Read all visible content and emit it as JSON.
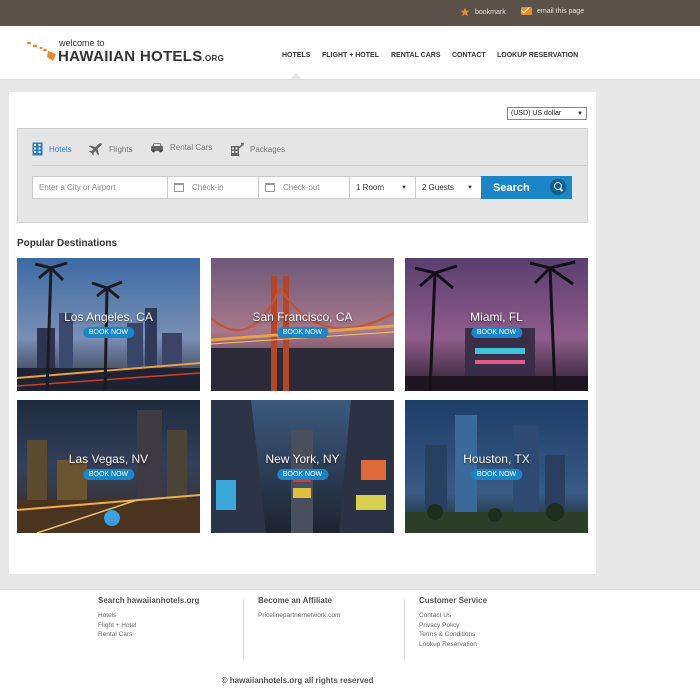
{
  "topbar": {
    "bookmark_label": "bookmark",
    "email_label": "email this page"
  },
  "logo": {
    "welcome": "welcome to",
    "name": "HAWAIIAN HOTELS",
    "suffix": ".ORG"
  },
  "nav": {
    "items": [
      {
        "label": "HOTELS"
      },
      {
        "label": "FLIGHT + HOTEL"
      },
      {
        "label": "RENTAL CARS"
      },
      {
        "label": "CONTACT"
      },
      {
        "label": "LOOKUP RESERVATION"
      }
    ]
  },
  "currency": {
    "selected": "(USD) US dollar"
  },
  "search": {
    "tabs": [
      {
        "label": "Hotels",
        "icon": "building-icon"
      },
      {
        "label": "Flights",
        "icon": "airplane-icon"
      },
      {
        "label": "Rental Cars",
        "icon": "car-icon"
      },
      {
        "label": "Packages",
        "icon": "package-icon"
      }
    ],
    "city_placeholder": "Enter a City or Airport",
    "checkin_placeholder": "Check-in",
    "checkout_placeholder": "Check-out",
    "rooms_value": "1 Room",
    "guests_value": "2 Guests",
    "button_label": "Search"
  },
  "popular": {
    "title": "Popular Destinations",
    "book_label": "BOOK NOW",
    "destinations": [
      {
        "city": "Los Angeles, CA"
      },
      {
        "city": "San Francisco, CA"
      },
      {
        "city": "Miami, FL"
      },
      {
        "city": "Las Vegas, NV"
      },
      {
        "city": "New York, NY"
      },
      {
        "city": "Houston, TX"
      }
    ]
  },
  "footer": {
    "col1": {
      "title": "Search hawaiianhotels.org",
      "links": [
        "Hotels",
        "Flight + Hotel",
        "Rental Cars"
      ]
    },
    "col2": {
      "title": "Become an Affiliate",
      "links": [
        "Pricelinepartnernetwork.com"
      ]
    },
    "col3": {
      "title": "Customer Service",
      "links": [
        "Contact Us",
        "Privacy Policy",
        "Terms & Conditions",
        "Lookup Reservation"
      ]
    },
    "copyright": "© hawaiianhotels.org all rights reserved"
  },
  "colors": {
    "topbar": "#5a5148",
    "accent_blue": "#1a86c6",
    "accent_orange": "#e98a2b"
  }
}
